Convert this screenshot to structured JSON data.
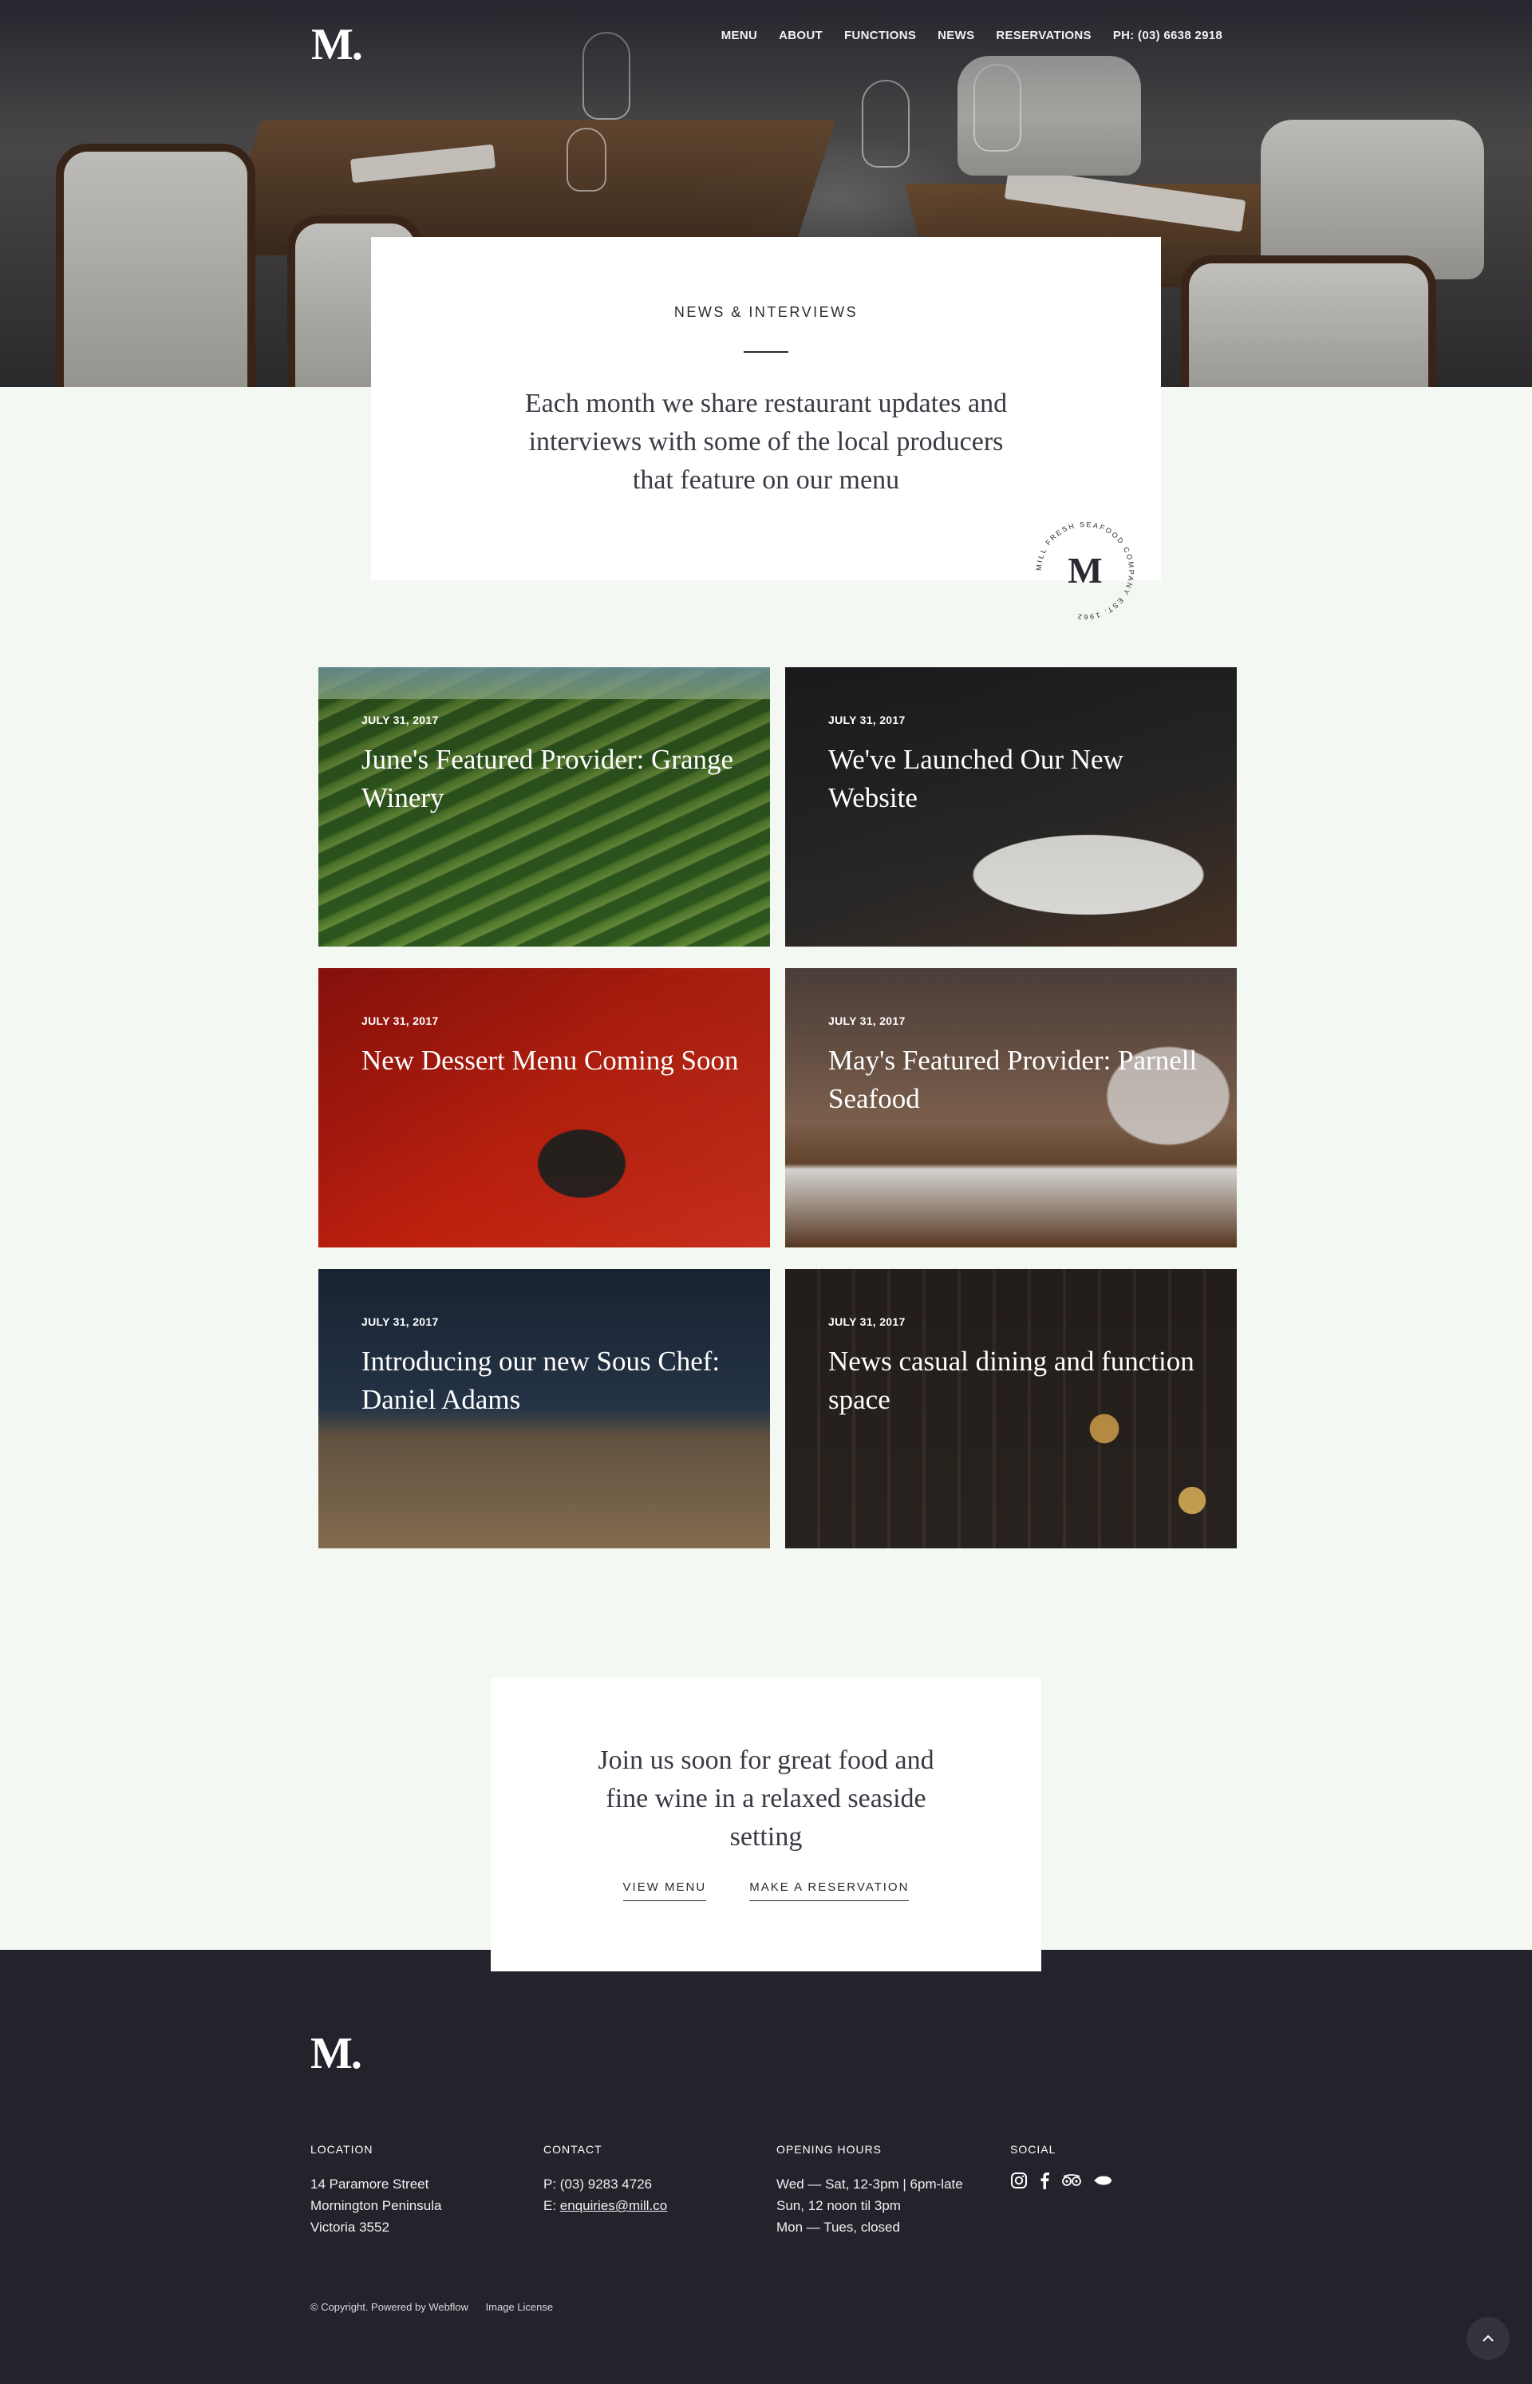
{
  "brand": {
    "logo_text": "M."
  },
  "nav": {
    "items": [
      "MENU",
      "ABOUT",
      "FUNCTIONS",
      "NEWS",
      "RESERVATIONS",
      "PH: (03) 6638 2918"
    ]
  },
  "intro": {
    "eyebrow": "NEWS & INTERVIEWS",
    "lead": "Each month we share restaurant updates and interviews with some of the local producers that feature on our menu"
  },
  "seal": {
    "letter": "M",
    "ring_text": "MILL FRESH SEAFOOD COMPANY EST. 1962"
  },
  "posts": [
    {
      "date": "JULY 31, 2017",
      "title": "June's Featured Provider: Grange Winery"
    },
    {
      "date": "JULY 31, 2017",
      "title": "We've Launched Our New Website"
    },
    {
      "date": "JULY 31, 2017",
      "title": "New Dessert Menu Coming Soon"
    },
    {
      "date": "JULY 31, 2017",
      "title": "May's Featured Provider: Parnell Seafood"
    },
    {
      "date": "JULY 31, 2017",
      "title": "Introducing our new Sous Chef: Daniel Adams"
    },
    {
      "date": "JULY 31, 2017",
      "title": "News casual dining and function space"
    }
  ],
  "cta": {
    "lead": "Join us soon for great food and fine wine in a relaxed seaside setting",
    "view_menu": "VIEW MENU",
    "reservation": "MAKE A RESERVATION"
  },
  "footer": {
    "logo_text": "M.",
    "location": {
      "heading": "LOCATION",
      "lines": [
        "14 Paramore Street",
        "Mornington Peninsula",
        "Victoria 3552"
      ]
    },
    "contact": {
      "heading": "CONTACT",
      "phone": "P: (03) 9283 4726",
      "email_prefix": "E: ",
      "email": "enquiries@mill.co"
    },
    "hours": {
      "heading": "OPENING HOURS",
      "lines": [
        "Wed — Sat, 12-3pm | 6pm-late",
        "Sun, 12 noon til 3pm",
        "Mon — Tues, closed"
      ]
    },
    "social": {
      "heading": "SOCIAL",
      "icons": [
        "instagram-icon",
        "facebook-icon",
        "tripadvisor-icon",
        "zomato-icon"
      ]
    },
    "copyright": "© Copyright. Powered by Webflow",
    "image_license": "Image License"
  },
  "colors": {
    "footer_bg": "#24232c",
    "page_bg": "#f4f8f3",
    "text_dark": "#2a2a33"
  }
}
